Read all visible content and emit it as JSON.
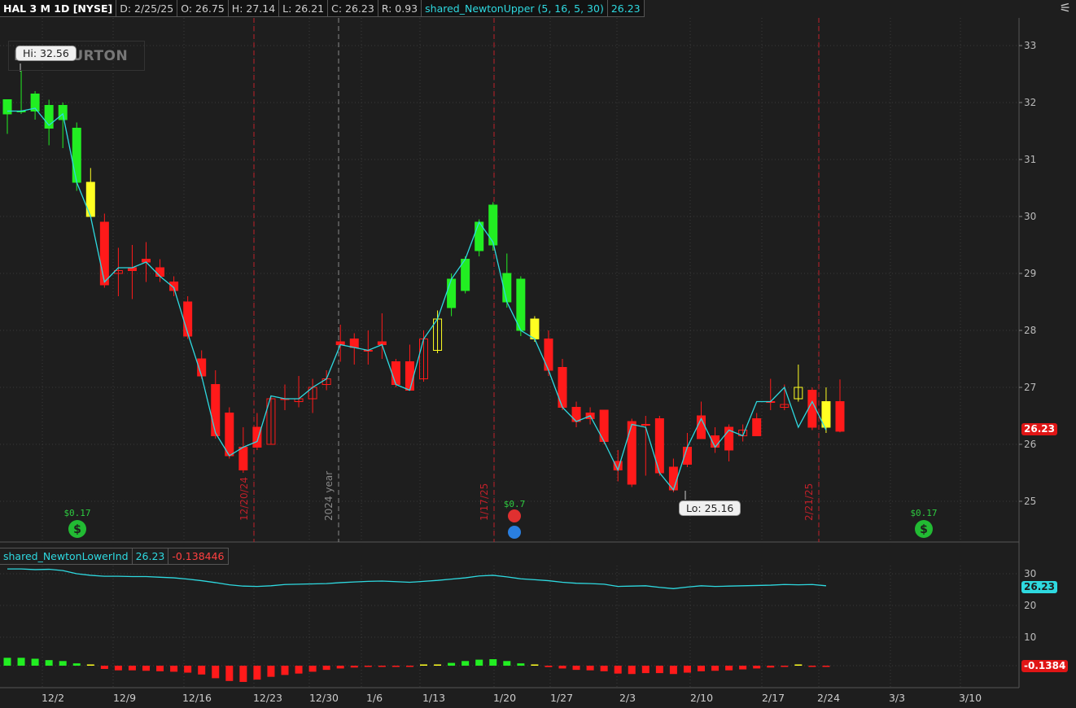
{
  "header": {
    "symbol": "HAL 3 M 1D [NYSE]",
    "date": "D: 2/25/25",
    "open": "O: 26.75",
    "high": "H: 27.14",
    "low": "L: 26.21",
    "close": "C: 26.23",
    "range": "R: 0.93",
    "study": "shared_NewtonUpper (5, 16, 5, 30)",
    "study_value": "26.23"
  },
  "logo_text": "HALLIBURTON",
  "annotations": {
    "hi": "Hi: 32.56",
    "lo": "Lo: 25.16",
    "div1": "$0.17",
    "div2": "$0.7",
    "div3": "$0.17"
  },
  "lower_header": {
    "study": "shared_NewtonLowerInd",
    "value1": "26.23",
    "value2": "-0.138446"
  },
  "price_tags": {
    "upper": "26.23",
    "lower_line": "26.23",
    "lower_hist": "-0.1384"
  },
  "vertical_labels": {
    "v1": "12/20/24",
    "v2": "2024 year",
    "v3": "1/17/25",
    "v4": "2/21/25"
  },
  "colors": {
    "up": "#22ee22",
    "down": "#ff1a1a",
    "neutral": "#ffff22",
    "line": "#2ed9e0",
    "bg": "#1e1e1e"
  },
  "chart_data": {
    "type": "candlestick",
    "price_axis": {
      "min": 25,
      "max": 33,
      "ticks": [
        "25",
        "26",
        "27",
        "28",
        "29",
        "30",
        "31",
        "32",
        "33"
      ]
    },
    "date_labels": [
      "12/2",
      "12/9",
      "12/16",
      "12/23",
      "12/30",
      "1/6",
      "1/13",
      "1/20",
      "1/27",
      "2/3",
      "2/10",
      "2/17",
      "2/24",
      "3/3",
      "3/10"
    ],
    "candles": [
      {
        "o": 31.8,
        "h": 32.05,
        "l": 31.45,
        "c": 32.05,
        "col": "up"
      },
      {
        "o": 31.85,
        "h": 32.56,
        "l": 31.8,
        "c": 31.85,
        "col": "up"
      },
      {
        "o": 31.85,
        "h": 32.2,
        "l": 31.7,
        "c": 32.15,
        "col": "up"
      },
      {
        "o": 31.95,
        "h": 32.05,
        "l": 31.25,
        "c": 31.55,
        "col": "up"
      },
      {
        "o": 31.7,
        "h": 32.0,
        "l": 31.2,
        "c": 31.95,
        "col": "up"
      },
      {
        "o": 31.55,
        "h": 31.65,
        "l": 30.45,
        "c": 30.6,
        "col": "up"
      },
      {
        "o": 30.6,
        "h": 30.85,
        "l": 30.0,
        "c": 30.0,
        "col": "neutral"
      },
      {
        "o": 29.9,
        "h": 30.05,
        "l": 28.75,
        "c": 28.8,
        "col": "down"
      },
      {
        "o": 29.0,
        "h": 29.45,
        "l": 28.6,
        "c": 29.05,
        "col": "down"
      },
      {
        "o": 29.1,
        "h": 29.5,
        "l": 28.55,
        "c": 29.05,
        "col": "down"
      },
      {
        "o": 29.25,
        "h": 29.55,
        "l": 28.85,
        "c": 29.2,
        "col": "down"
      },
      {
        "o": 29.1,
        "h": 29.25,
        "l": 28.85,
        "c": 28.95,
        "col": "down"
      },
      {
        "o": 28.85,
        "h": 28.95,
        "l": 28.6,
        "c": 28.7,
        "col": "down"
      },
      {
        "o": 28.5,
        "h": 28.6,
        "l": 27.85,
        "c": 27.9,
        "col": "down"
      },
      {
        "o": 27.5,
        "h": 27.65,
        "l": 27.15,
        "c": 27.2,
        "col": "down"
      },
      {
        "o": 27.05,
        "h": 27.3,
        "l": 26.1,
        "c": 26.15,
        "col": "down"
      },
      {
        "o": 26.55,
        "h": 26.65,
        "l": 25.75,
        "c": 25.8,
        "col": "down"
      },
      {
        "o": 25.95,
        "h": 26.3,
        "l": 25.5,
        "c": 25.55,
        "col": "down"
      },
      {
        "o": 26.3,
        "h": 26.55,
        "l": 25.9,
        "c": 25.95,
        "col": "down"
      },
      {
        "o": 26.0,
        "h": 26.85,
        "l": 26.0,
        "c": 26.8,
        "col": "down"
      },
      {
        "o": 26.8,
        "h": 27.05,
        "l": 26.6,
        "c": 26.8,
        "col": "down"
      },
      {
        "o": 26.75,
        "h": 27.2,
        "l": 26.65,
        "c": 26.8,
        "col": "down"
      },
      {
        "o": 26.8,
        "h": 27.15,
        "l": 26.55,
        "c": 27.0,
        "col": "down"
      },
      {
        "o": 27.05,
        "h": 27.3,
        "l": 26.95,
        "c": 27.15,
        "col": "down"
      },
      {
        "o": 27.8,
        "h": 28.1,
        "l": 27.45,
        "c": 27.75,
        "col": "down"
      },
      {
        "o": 27.85,
        "h": 27.95,
        "l": 27.4,
        "c": 27.7,
        "col": "down"
      },
      {
        "o": 27.65,
        "h": 28.0,
        "l": 27.4,
        "c": 27.65,
        "col": "down"
      },
      {
        "o": 27.8,
        "h": 28.3,
        "l": 27.5,
        "c": 27.75,
        "col": "down"
      },
      {
        "o": 27.45,
        "h": 27.5,
        "l": 27.0,
        "c": 27.05,
        "col": "down"
      },
      {
        "o": 27.45,
        "h": 27.75,
        "l": 26.95,
        "c": 26.95,
        "col": "down"
      },
      {
        "o": 27.15,
        "h": 28.0,
        "l": 27.1,
        "c": 27.85,
        "col": "down"
      },
      {
        "o": 27.65,
        "h": 28.35,
        "l": 27.6,
        "c": 28.2,
        "col": "neutral"
      },
      {
        "o": 28.4,
        "h": 29.0,
        "l": 28.25,
        "c": 28.9,
        "col": "up"
      },
      {
        "o": 28.7,
        "h": 29.3,
        "l": 28.65,
        "c": 29.25,
        "col": "up"
      },
      {
        "o": 29.4,
        "h": 29.95,
        "l": 29.3,
        "c": 29.9,
        "col": "up"
      },
      {
        "o": 29.5,
        "h": 30.25,
        "l": 29.4,
        "c": 30.2,
        "col": "up"
      },
      {
        "o": 29.0,
        "h": 29.35,
        "l": 28.4,
        "c": 28.5,
        "col": "up"
      },
      {
        "o": 28.9,
        "h": 28.95,
        "l": 27.9,
        "c": 28.0,
        "col": "up"
      },
      {
        "o": 28.2,
        "h": 28.25,
        "l": 27.8,
        "c": 27.85,
        "col": "neutral"
      },
      {
        "o": 27.85,
        "h": 28.0,
        "l": 27.2,
        "c": 27.3,
        "col": "down"
      },
      {
        "o": 27.35,
        "h": 27.5,
        "l": 26.6,
        "c": 26.65,
        "col": "down"
      },
      {
        "o": 26.65,
        "h": 26.75,
        "l": 26.3,
        "c": 26.4,
        "col": "down"
      },
      {
        "o": 26.55,
        "h": 26.65,
        "l": 26.35,
        "c": 26.45,
        "col": "down"
      },
      {
        "o": 26.6,
        "h": 26.6,
        "l": 26.0,
        "c": 26.05,
        "col": "down"
      },
      {
        "o": 25.7,
        "h": 25.9,
        "l": 25.35,
        "c": 25.55,
        "col": "down"
      },
      {
        "o": 26.4,
        "h": 26.45,
        "l": 25.25,
        "c": 25.3,
        "col": "down"
      },
      {
        "o": 26.35,
        "h": 26.5,
        "l": 25.45,
        "c": 26.35,
        "col": "down"
      },
      {
        "o": 26.45,
        "h": 26.5,
        "l": 25.45,
        "c": 25.5,
        "col": "down"
      },
      {
        "o": 25.6,
        "h": 25.75,
        "l": 25.16,
        "c": 25.2,
        "col": "down"
      },
      {
        "o": 25.95,
        "h": 26.2,
        "l": 25.6,
        "c": 25.65,
        "col": "down"
      },
      {
        "o": 26.5,
        "h": 26.75,
        "l": 26.1,
        "c": 26.1,
        "col": "down"
      },
      {
        "o": 26.15,
        "h": 26.3,
        "l": 25.85,
        "c": 25.95,
        "col": "down"
      },
      {
        "o": 26.3,
        "h": 26.35,
        "l": 25.7,
        "c": 25.9,
        "col": "down"
      },
      {
        "o": 26.15,
        "h": 26.35,
        "l": 26.05,
        "c": 26.25,
        "col": "down"
      },
      {
        "o": 26.45,
        "h": 26.55,
        "l": 26.15,
        "c": 26.15,
        "col": "down"
      },
      {
        "o": 26.75,
        "h": 27.15,
        "l": 26.6,
        "c": 26.75,
        "col": "down"
      },
      {
        "o": 26.65,
        "h": 27.05,
        "l": 26.6,
        "c": 26.7,
        "col": "down"
      },
      {
        "o": 26.8,
        "h": 27.4,
        "l": 26.75,
        "c": 27.0,
        "col": "neutral"
      },
      {
        "o": 26.95,
        "h": 27.0,
        "l": 26.25,
        "c": 26.3,
        "col": "down"
      },
      {
        "o": 26.75,
        "h": 27.0,
        "l": 26.2,
        "c": 26.3,
        "col": "neutral"
      },
      {
        "o": 26.75,
        "h": 27.14,
        "l": 26.21,
        "c": 26.23,
        "col": "down"
      }
    ],
    "upper_line": [
      31.85,
      31.85,
      31.9,
      31.6,
      31.8,
      30.6,
      30.0,
      28.85,
      29.1,
      29.1,
      29.2,
      28.95,
      28.75,
      27.95,
      27.2,
      26.2,
      25.8,
      25.95,
      26.05,
      26.85,
      26.8,
      26.8,
      27.0,
      27.15,
      27.75,
      27.7,
      27.65,
      27.75,
      27.05,
      26.95,
      27.85,
      28.2,
      28.9,
      29.25,
      29.9,
      29.55,
      28.5,
      28.0,
      27.85,
      27.3,
      26.65,
      26.4,
      26.5,
      26.05,
      25.55,
      26.35,
      26.3,
      25.5,
      25.2,
      25.95,
      26.45,
      25.95,
      26.25,
      26.15,
      26.75,
      26.75,
      27.0,
      26.3,
      26.75,
      26.25
    ],
    "lower_axis": {
      "ticks": [
        "30",
        "20",
        "10"
      ]
    },
    "lower_line": [
      31.5,
      31.5,
      31.3,
      31.4,
      31.0,
      30.0,
      29.5,
      29.2,
      29.2,
      29.1,
      29.1,
      28.9,
      28.7,
      28.3,
      27.8,
      27.2,
      26.5,
      26.1,
      26.0,
      26.2,
      26.6,
      26.7,
      26.8,
      26.9,
      27.2,
      27.4,
      27.6,
      27.7,
      27.5,
      27.3,
      27.6,
      27.9,
      28.3,
      28.7,
      29.3,
      29.5,
      29.0,
      28.4,
      28.1,
      27.8,
      27.3,
      27.0,
      26.9,
      26.7,
      26.0,
      26.1,
      26.2,
      25.7,
      25.3,
      25.8,
      26.2,
      26.0,
      26.1,
      26.2,
      26.3,
      26.4,
      26.6,
      26.5,
      26.6,
      26.2
    ],
    "hist": [
      0.17,
      0.17,
      0.15,
      0.12,
      0.1,
      0.05,
      0,
      -0.07,
      -0.1,
      -0.1,
      -0.11,
      -0.12,
      -0.13,
      -0.15,
      -0.19,
      -0.27,
      -0.33,
      -0.35,
      -0.3,
      -0.24,
      -0.2,
      -0.17,
      -0.13,
      -0.09,
      -0.06,
      -0.04,
      -0.02,
      -0.01,
      -0.02,
      -0.01,
      0.01,
      0.02,
      0.06,
      0.1,
      0.13,
      0.14,
      0.1,
      0.05,
      0.01,
      -0.03,
      -0.06,
      -0.09,
      -0.1,
      -0.12,
      -0.17,
      -0.18,
      -0.16,
      -0.16,
      -0.18,
      -0.15,
      -0.12,
      -0.11,
      -0.1,
      -0.08,
      -0.06,
      -0.04,
      -0.02,
      0.01,
      -0.01,
      -0.01
    ],
    "hist_colors": [
      "up",
      "up",
      "up",
      "up",
      "up",
      "up",
      "neutral",
      "down",
      "down",
      "down",
      "down",
      "down",
      "down",
      "down",
      "down",
      "down",
      "down",
      "down",
      "down",
      "down",
      "down",
      "down",
      "down",
      "down",
      "down",
      "down",
      "down",
      "down",
      "down",
      "down",
      "neutral",
      "neutral",
      "up",
      "up",
      "up",
      "up",
      "up",
      "up",
      "neutral",
      "down",
      "down",
      "down",
      "down",
      "down",
      "down",
      "down",
      "down",
      "down",
      "down",
      "down",
      "down",
      "down",
      "down",
      "down",
      "down",
      "down",
      "down",
      "neutral",
      "down",
      "down"
    ]
  }
}
